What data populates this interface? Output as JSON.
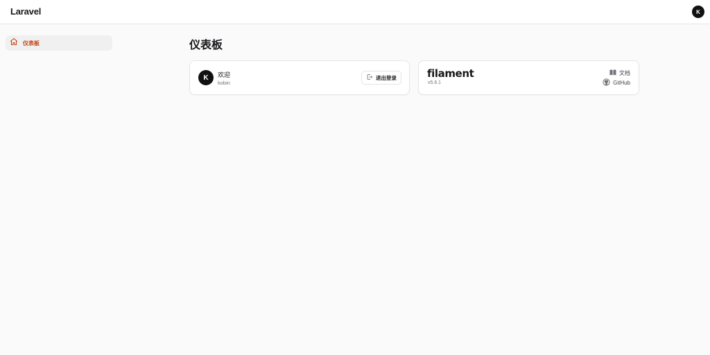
{
  "header": {
    "brand": "Laravel",
    "user_initial": "K"
  },
  "sidebar": {
    "items": [
      {
        "label": "仪表板",
        "icon": "home-icon",
        "active": true
      }
    ]
  },
  "main": {
    "title": "仪表板",
    "welcome_card": {
      "avatar_initial": "K",
      "title": "欢迎",
      "username": "kobin",
      "logout_label": "退出登录"
    },
    "info_card": {
      "logo_text": "filament",
      "version": "v5.6.1",
      "links": [
        {
          "label": "文档",
          "icon": "book-icon"
        },
        {
          "label": "GitHub",
          "icon": "github-icon"
        }
      ]
    }
  },
  "colors": {
    "accent": "#c2410c",
    "background": "#fafafa",
    "card": "#ffffff"
  }
}
